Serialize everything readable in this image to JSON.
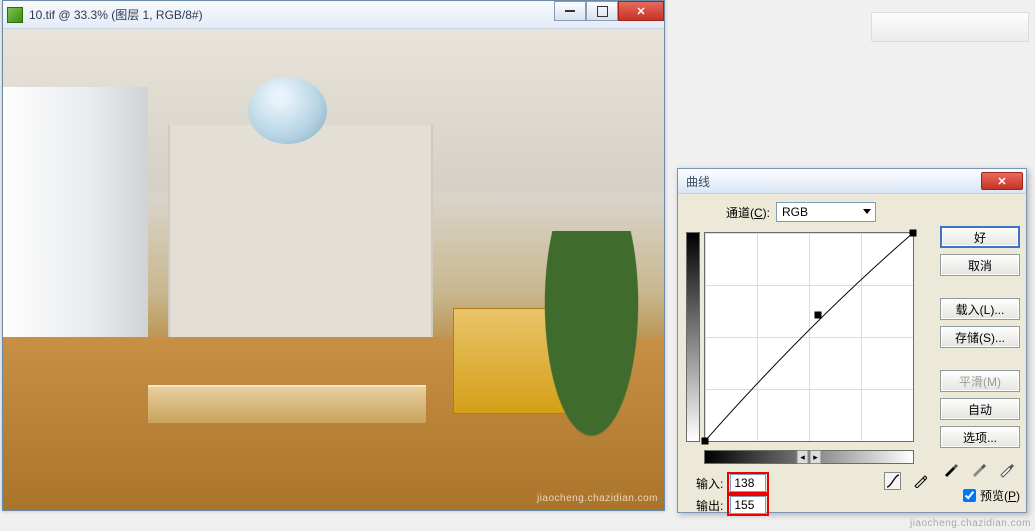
{
  "doc_window": {
    "title": "10.tif @ 33.3% (图层 1, RGB/8#)"
  },
  "blank_panel": {},
  "curves_dialog": {
    "title": "曲线",
    "channel_label_pre": "通道(",
    "channel_label_key": "C",
    "channel_label_post": "):",
    "channel_value": "RGB",
    "input_label": "输入:",
    "output_label": "输出:",
    "input_value": "138",
    "output_value": "155",
    "buttons": {
      "ok": "好",
      "cancel": "取消",
      "load": "载入(L)...",
      "save": "存储(S)...",
      "smooth": "平滑(M)",
      "auto": "自动",
      "options": "选项..."
    },
    "preview_label_pre": "预览(",
    "preview_label_key": "P",
    "preview_label_post": ")",
    "preview_checked": true
  },
  "chart_data": {
    "type": "line",
    "title": "曲线",
    "xlabel": "输入",
    "ylabel": "输出",
    "xlim": [
      0,
      255
    ],
    "ylim": [
      0,
      255
    ],
    "series": [
      {
        "name": "RGB",
        "points": [
          {
            "x": 0,
            "y": 0
          },
          {
            "x": 138,
            "y": 155
          },
          {
            "x": 255,
            "y": 255
          }
        ]
      }
    ],
    "anchors": [
      {
        "x": 0,
        "y": 0
      },
      {
        "x": 138,
        "y": 155
      },
      {
        "x": 255,
        "y": 255
      }
    ]
  },
  "watermark": "jiaocheng.chazidian.com"
}
